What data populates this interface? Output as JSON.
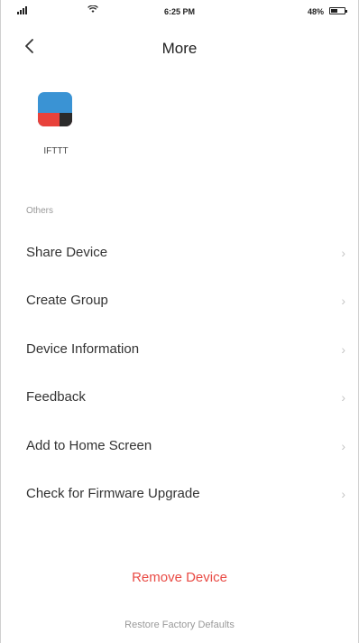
{
  "status_bar": {
    "time": "6:25 PM",
    "battery_percent": "48%"
  },
  "nav": {
    "title": "More"
  },
  "device": {
    "name": "IFTTT"
  },
  "section": {
    "header": "Others"
  },
  "menu": {
    "items": [
      {
        "label": "Share Device"
      },
      {
        "label": "Create Group"
      },
      {
        "label": "Device Information"
      },
      {
        "label": "Feedback"
      },
      {
        "label": "Add to Home Screen"
      },
      {
        "label": "Check for Firmware Upgrade"
      }
    ],
    "chevron": "›"
  },
  "actions": {
    "remove_label": "Remove Device",
    "restore_label": "Restore Factory Defaults"
  },
  "colors": {
    "accent_red": "#e94b45",
    "icon_blue": "#3a93d4",
    "icon_red": "#e8423b"
  }
}
